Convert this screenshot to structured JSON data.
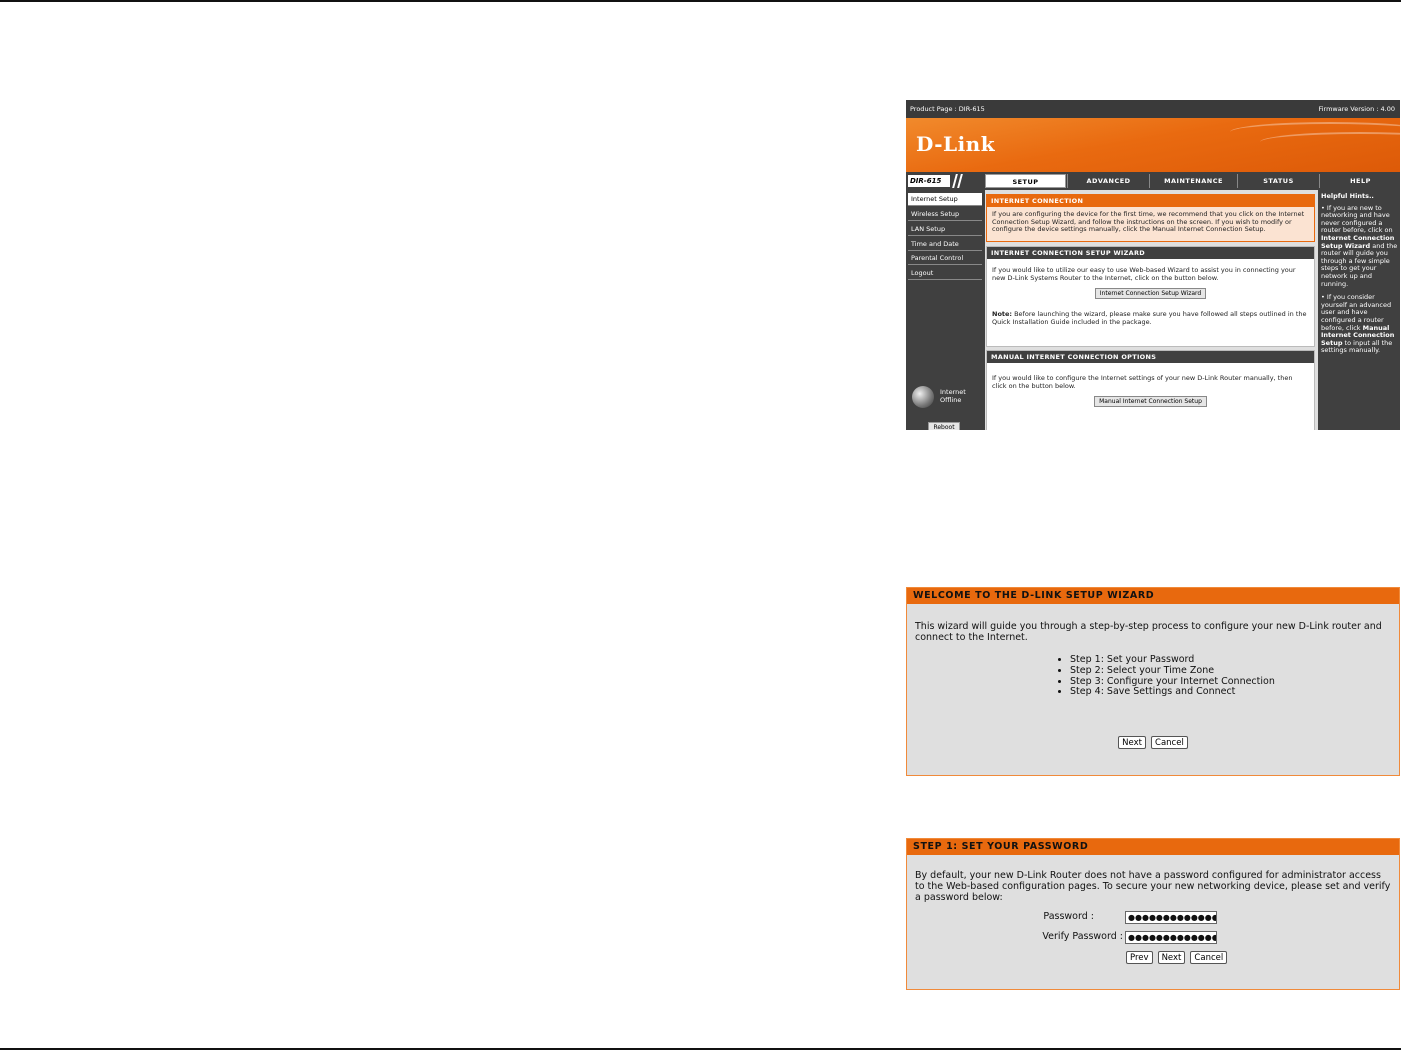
{
  "router": {
    "product_page": "Product Page : DIR-615",
    "firmware": "Firmware Version : 4.00",
    "logo": "D-Link",
    "model": "DIR-615",
    "tabs": [
      "SETUP",
      "ADVANCED",
      "MAINTENANCE",
      "STATUS",
      "HELP"
    ],
    "nav": [
      "Internet Setup",
      "Wireless Setup",
      "LAN Setup",
      "Time and Date",
      "Parental Control",
      "Logout"
    ],
    "status_line1": "Internet",
    "status_line2": "Offline",
    "reboot": "Reboot",
    "sections": {
      "connection": {
        "title": "INTERNET CONNECTION",
        "text": "If you are configuring the device for the first time, we recommend that you click on the Internet Connection Setup Wizard, and follow the instructions on the screen. If you wish to modify or configure the device settings manually, click the Manual Internet Connection Setup."
      },
      "wizard": {
        "title": "INTERNET CONNECTION SETUP WIZARD",
        "text": "If you would like to utilize our easy to use Web-based Wizard to assist you in connecting your new D-Link Systems Router to the Internet, click on the button below.",
        "button": "Internet Connection Setup Wizard",
        "note_label": "Note:",
        "note": " Before launching the wizard, please make sure you have followed all steps outlined in the Quick Installation Guide included in the package."
      },
      "manual": {
        "title": "MANUAL INTERNET CONNECTION OPTIONS",
        "text": "If you would like to configure the Internet settings of your new D-Link Router manually, then click on the button below.",
        "button": "Manual Internet Connection Setup"
      }
    },
    "hints": {
      "title": "Helpful Hints..",
      "hint1_pre": "• If you are new to networking and have never configured a router before, click on ",
      "hint1_bold": "Internet Connection Setup Wizard",
      "hint1_post": " and the router will guide you through a few simple steps to get your network up and running.",
      "hint2_pre": "• If you consider yourself an advanced user and have configured a router before, click ",
      "hint2_bold": "Manual Internet Connection Setup",
      "hint2_post": " to input all the settings manually."
    }
  },
  "welcome": {
    "title": "WELCOME TO THE D-LINK SETUP WIZARD",
    "text": "This wizard will guide you through a step-by-step process to configure your new D-Link router and connect to the Internet.",
    "steps": [
      "Step 1: Set your Password",
      "Step 2: Select your Time Zone",
      "Step 3: Configure your Internet Connection",
      "Step 4: Save Settings and Connect"
    ],
    "next": "Next",
    "cancel": "Cancel"
  },
  "step1": {
    "title": "STEP 1: SET YOUR PASSWORD",
    "text": "By default, your new D-Link Router does not have a password configured for administrator access to the Web-based configuration pages. To secure your new networking device, please set and verify a password below:",
    "password_label": "Password :",
    "verify_label": "Verify Password :",
    "password_value": "●●●●●●●●●●●●●●●",
    "verify_value": "●●●●●●●●●●●●●●●",
    "prev": "Prev",
    "next": "Next",
    "cancel": "Cancel"
  },
  "colors": {
    "orange": "#e8690e",
    "dark": "#404040",
    "panel_bg": "#dfdfdf"
  }
}
